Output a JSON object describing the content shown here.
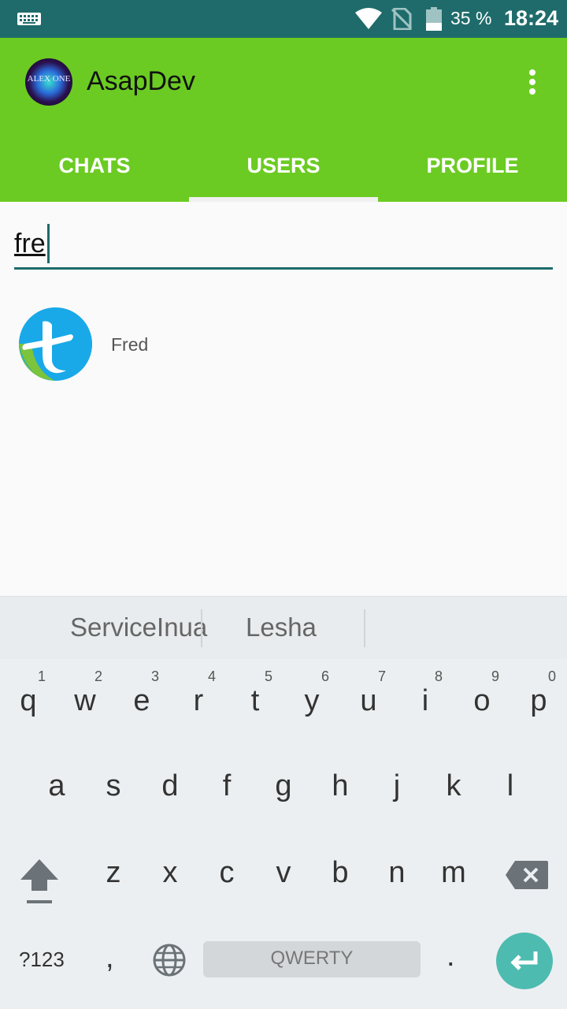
{
  "status_bar": {
    "battery_percent": "35 %",
    "time": "18:24",
    "icons": [
      "keyboard-icon",
      "wifi-icon",
      "no-sim-icon",
      "battery-icon"
    ]
  },
  "app_bar": {
    "title": "AsapDev",
    "logo_text": "ALEX ONE",
    "background_color": "#6bcb22",
    "tabs": [
      {
        "label": "CHATS",
        "selected": false
      },
      {
        "label": "USERS",
        "selected": true
      },
      {
        "label": "PROFILE",
        "selected": false
      }
    ]
  },
  "search": {
    "value": "fre"
  },
  "users": [
    {
      "name": "Fred",
      "avatar": "t-logo"
    }
  ],
  "keyboard": {
    "suggestions": [
      "ServiceInua",
      "Lesha"
    ],
    "row1": [
      {
        "ch": "q",
        "hint": "1"
      },
      {
        "ch": "w",
        "hint": "2"
      },
      {
        "ch": "e",
        "hint": "3"
      },
      {
        "ch": "r",
        "hint": "4"
      },
      {
        "ch": "t",
        "hint": "5"
      },
      {
        "ch": "y",
        "hint": "6"
      },
      {
        "ch": "u",
        "hint": "7"
      },
      {
        "ch": "i",
        "hint": "8"
      },
      {
        "ch": "o",
        "hint": "9"
      },
      {
        "ch": "p",
        "hint": "0"
      }
    ],
    "row2": [
      "a",
      "s",
      "d",
      "f",
      "g",
      "h",
      "j",
      "k",
      "l"
    ],
    "row3": [
      "z",
      "x",
      "c",
      "v",
      "b",
      "n",
      "m"
    ],
    "symbols_label": "?123",
    "comma": ",",
    "space_label": "QWERTY",
    "period": ".",
    "accent_color": "#4dbbb0"
  }
}
